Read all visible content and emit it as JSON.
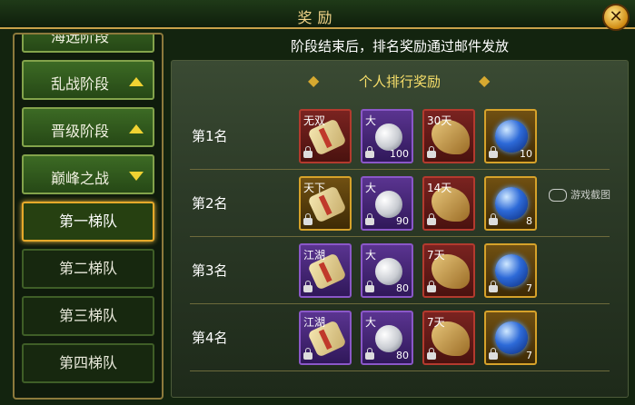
{
  "window": {
    "title": "奖励",
    "close_icon": "close-icon"
  },
  "sidebar": {
    "partial_top_label": "海选阶段",
    "stages": [
      {
        "label": "乱战阶段",
        "arrow": "up"
      },
      {
        "label": "晋级阶段",
        "arrow": "up"
      },
      {
        "label": "巅峰之战",
        "arrow": "down"
      }
    ],
    "teams": [
      {
        "label": "第一梯队",
        "active": true
      },
      {
        "label": "第二梯队",
        "active": false
      },
      {
        "label": "第三梯队",
        "active": false
      },
      {
        "label": "第四梯队",
        "active": false
      }
    ]
  },
  "main": {
    "notice": "阶段结束后，排名奖励通过邮件发放",
    "section_title": "个人排行奖励",
    "ranks": [
      {
        "label": "第1名",
        "items": [
          {
            "icon": "scroll-icon",
            "tag": "无双",
            "count": "",
            "frame": "red"
          },
          {
            "icon": "pearl-icon",
            "tag": "大",
            "count": "100",
            "frame": "purple"
          },
          {
            "icon": "dragon-icon",
            "tag": "30天",
            "count": "",
            "frame": "red"
          },
          {
            "icon": "orb-icon",
            "tag": "",
            "count": "10",
            "frame": "gold"
          }
        ]
      },
      {
        "label": "第2名",
        "items": [
          {
            "icon": "scroll-icon",
            "tag": "天下",
            "count": "",
            "frame": "gold"
          },
          {
            "icon": "pearl-icon",
            "tag": "大",
            "count": "90",
            "frame": "purple"
          },
          {
            "icon": "dragon-icon",
            "tag": "14天",
            "count": "",
            "frame": "red"
          },
          {
            "icon": "orb-icon",
            "tag": "",
            "count": "8",
            "frame": "gold"
          }
        ]
      },
      {
        "label": "第3名",
        "items": [
          {
            "icon": "scroll-icon",
            "tag": "江湖",
            "count": "",
            "frame": "purple"
          },
          {
            "icon": "pearl-icon",
            "tag": "大",
            "count": "80",
            "frame": "purple"
          },
          {
            "icon": "dragon-icon",
            "tag": "7天",
            "count": "",
            "frame": "red"
          },
          {
            "icon": "orb-icon",
            "tag": "",
            "count": "7",
            "frame": "gold"
          }
        ]
      },
      {
        "label": "第4名",
        "items": [
          {
            "icon": "scroll-icon",
            "tag": "江湖",
            "count": "",
            "frame": "purple"
          },
          {
            "icon": "pearl-icon",
            "tag": "大",
            "count": "80",
            "frame": "purple"
          },
          {
            "icon": "dragon-icon",
            "tag": "7天",
            "count": "",
            "frame": "red"
          },
          {
            "icon": "orb-icon",
            "tag": "",
            "count": "7",
            "frame": "gold"
          }
        ]
      }
    ]
  },
  "watermark": "游戏截图"
}
